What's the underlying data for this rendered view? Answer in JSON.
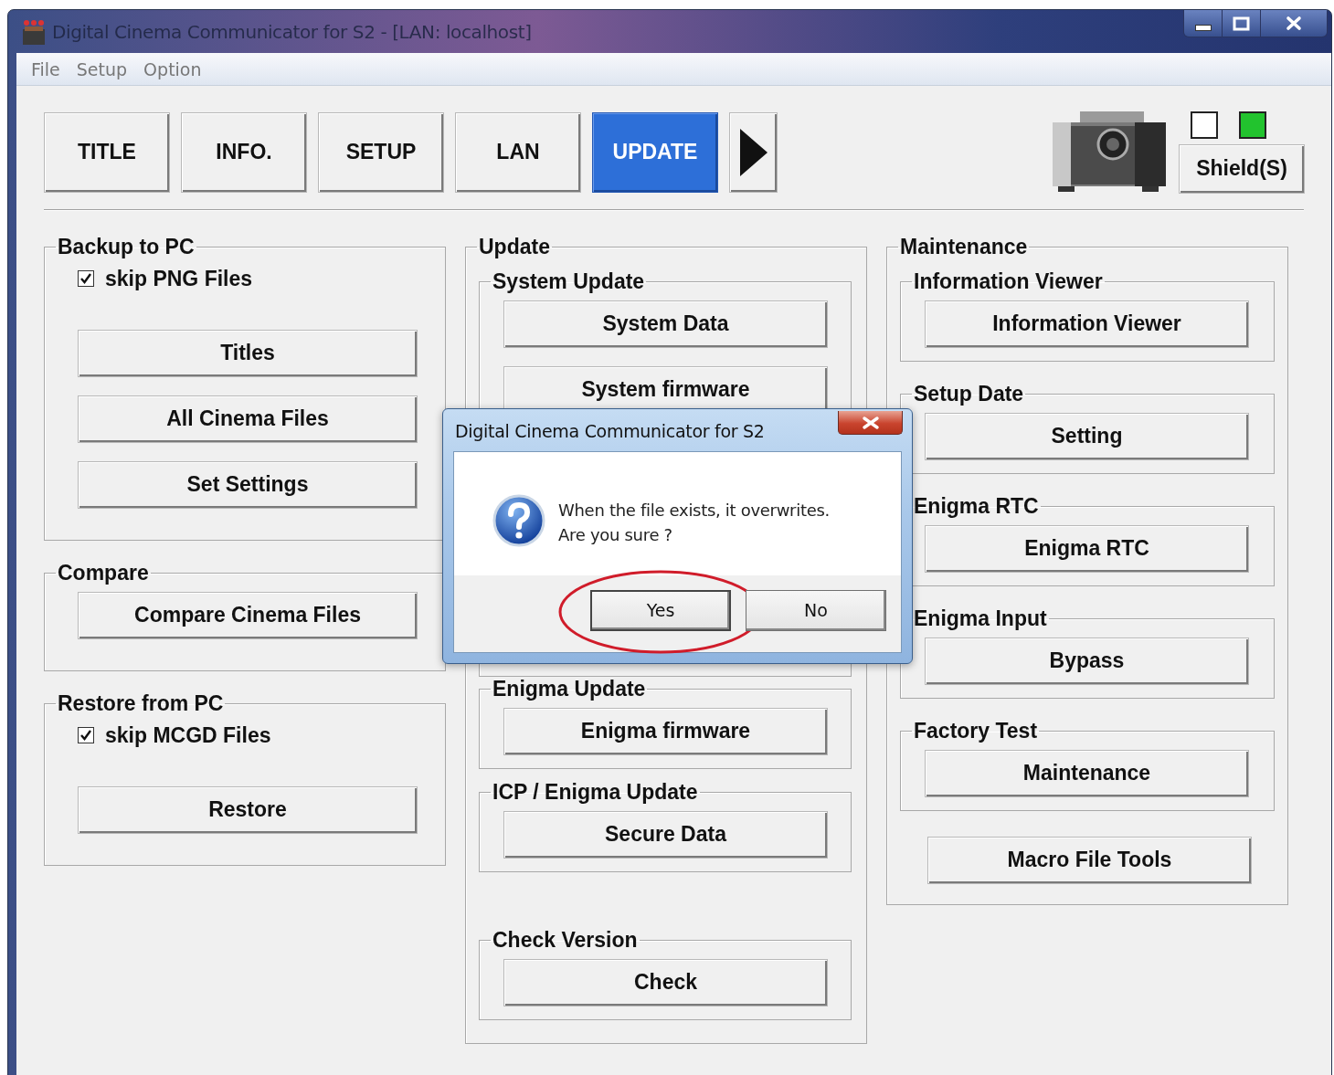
{
  "window": {
    "title": "Digital Cinema Communicator for S2 - [LAN: localhost]"
  },
  "menu": [
    "File",
    "Setup",
    "Option"
  ],
  "tabs": [
    {
      "label": "TITLE",
      "selected": false
    },
    {
      "label": "INFO.",
      "selected": false
    },
    {
      "label": "SETUP",
      "selected": false
    },
    {
      "label": "LAN",
      "selected": false
    },
    {
      "label": "UPDATE",
      "selected": true
    }
  ],
  "device": {
    "indicators": [
      {
        "color": "#ffffff"
      },
      {
        "color": "#22c32e"
      }
    ],
    "shield_button": "Shield(S)"
  },
  "columns": [
    {
      "groups": [
        {
          "title": "Backup to PC",
          "items": [
            {
              "kind": "checkbox",
              "label": "skip PNG Files",
              "checked": true
            },
            {
              "kind": "button",
              "label": "Titles"
            },
            {
              "kind": "button",
              "label": "All Cinema Files"
            },
            {
              "kind": "button",
              "label": "Set Settings"
            }
          ]
        },
        {
          "title": "Compare",
          "items": [
            {
              "kind": "button",
              "label": "Compare Cinema Files"
            }
          ]
        },
        {
          "title": "Restore from PC",
          "items": [
            {
              "kind": "checkbox",
              "label": "skip MCGD Files",
              "checked": true
            },
            {
              "kind": "button",
              "label": "Restore"
            }
          ]
        }
      ]
    },
    {
      "groups": [
        {
          "title": "Update",
          "items": [
            {
              "kind": "group",
              "title": "System Update",
              "items": [
                {
                  "kind": "button",
                  "label": "System Data"
                },
                {
                  "kind": "button",
                  "label": "System firmware"
                }
              ]
            },
            {
              "kind": "group",
              "title": "Enigma Update",
              "items": [
                {
                  "kind": "button",
                  "label": "Enigma firmware"
                }
              ]
            },
            {
              "kind": "group",
              "title": "ICP / Enigma Update",
              "items": [
                {
                  "kind": "button",
                  "label": "Secure Data"
                }
              ]
            },
            {
              "kind": "group",
              "title": "Check Version",
              "items": [
                {
                  "kind": "button",
                  "label": "Check"
                }
              ]
            }
          ]
        }
      ]
    },
    {
      "groups": [
        {
          "title": "Maintenance",
          "items": [
            {
              "kind": "group",
              "title": "Information Viewer",
              "items": [
                {
                  "kind": "button",
                  "label": "Information Viewer"
                }
              ]
            },
            {
              "kind": "group",
              "title": "Setup Date",
              "items": [
                {
                  "kind": "button",
                  "label": "Setting"
                }
              ]
            },
            {
              "kind": "group",
              "title": "Enigma RTC",
              "items": [
                {
                  "kind": "button",
                  "label": "Enigma RTC"
                }
              ]
            },
            {
              "kind": "group",
              "title": "Enigma Input",
              "items": [
                {
                  "kind": "button",
                  "label": "Bypass"
                }
              ]
            },
            {
              "kind": "group",
              "title": "Factory Test",
              "items": [
                {
                  "kind": "button",
                  "label": "Maintenance"
                }
              ]
            },
            {
              "kind": "button",
              "label": "Macro File Tools"
            }
          ]
        }
      ]
    }
  ],
  "dialog": {
    "title": "Digital Cinema Communicator for S2",
    "message": "When the file exists, it overwrites.\nAre you sure ?",
    "buttons": [
      {
        "label": "Yes",
        "circled": true
      },
      {
        "label": "No",
        "circled": false
      }
    ]
  }
}
